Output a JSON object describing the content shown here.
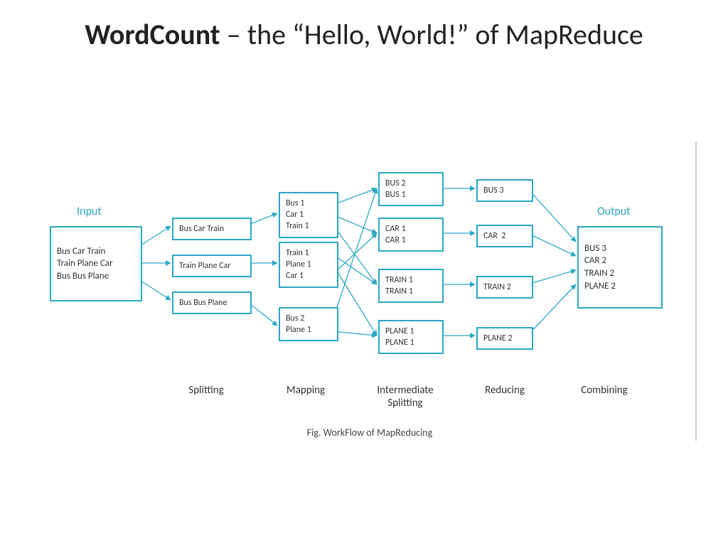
{
  "title_bold": "WordCount",
  "title_rest": " – the “Hello, World!” of MapReduce",
  "labels": {
    "input": "Input",
    "output": "Output"
  },
  "input_box": "Bus Car Train\nTrain Plane Car\nBus Bus Plane",
  "split": {
    "s1": "Bus Car Train",
    "s2": "Train Plane Car",
    "s3": "Bus Bus Plane"
  },
  "map": {
    "m1": "Bus 1\nCar 1\nTrain 1",
    "m2": "Train 1\nPlane 1\nCar 1",
    "m3": "Bus 2\nPlane 1"
  },
  "intermediate": {
    "i1": "BUS 2\nBUS 1",
    "i2": "CAR 1\nCAR 1",
    "i3": "TRAIN 1\nTRAIN 1",
    "i4": "PLANE 1\nPLANE 1"
  },
  "reduce": {
    "r1": "BUS 3",
    "r2": "CAR  2",
    "r3": "TRAIN 2",
    "r4": "PLANE 2"
  },
  "output_box": "BUS 3\nCAR 2\nTRAIN 2\nPLANE 2",
  "stages": {
    "splitting": "Splitting",
    "mapping": "Mapping",
    "intermediate": "Intermediate\nSplitting",
    "reducing": "Reducing",
    "combining": "Combining"
  },
  "caption": "Fig. WorkFlow of MapReducing"
}
